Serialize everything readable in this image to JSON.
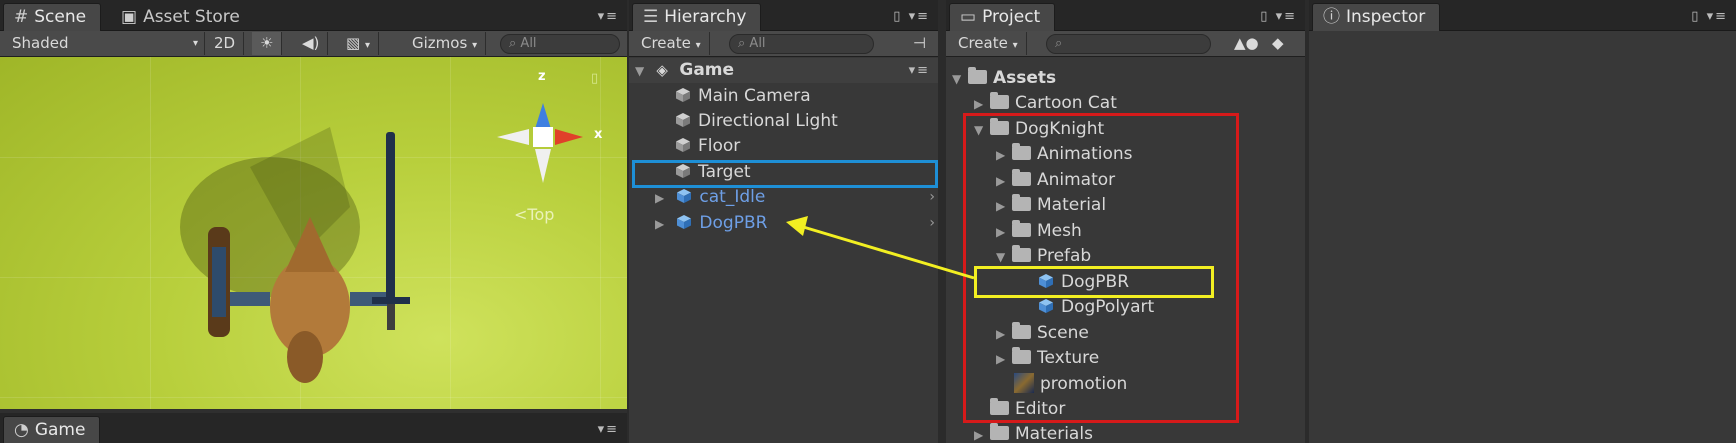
{
  "scene_panel": {
    "tabs": [
      {
        "label": "Scene"
      },
      {
        "label": "Asset Store"
      }
    ],
    "toolbar": {
      "shading": "Shaded",
      "mode_2d": "2D",
      "gizmos": "Gizmos",
      "search_placeholder": "All"
    },
    "gizmo": {
      "axis_z": "z",
      "axis_x": "x",
      "view_label": "Top"
    }
  },
  "game_tab": {
    "label": "Game"
  },
  "hierarchy": {
    "tab": "Hierarchy",
    "create": "Create",
    "search_placeholder": "All",
    "scene_name": "Game",
    "items": [
      {
        "label": "Main Camera"
      },
      {
        "label": "Directional Light"
      },
      {
        "label": "Floor"
      },
      {
        "label": "Target"
      },
      {
        "label": "cat_Idle"
      },
      {
        "label": "DogPBR"
      }
    ]
  },
  "project": {
    "tab": "Project",
    "create": "Create",
    "tree": [
      {
        "label": "Assets"
      },
      {
        "label": "Cartoon Cat"
      },
      {
        "label": "DogKnight"
      },
      {
        "label": "Animations"
      },
      {
        "label": "Animator"
      },
      {
        "label": "Material"
      },
      {
        "label": "Mesh"
      },
      {
        "label": "Prefab"
      },
      {
        "label": "DogPBR"
      },
      {
        "label": "DogPolyart"
      },
      {
        "label": "Scene"
      },
      {
        "label": "Texture"
      },
      {
        "label": "promotion"
      },
      {
        "label": "Editor"
      },
      {
        "label": "Materials"
      }
    ]
  },
  "inspector": {
    "tab": "Inspector"
  },
  "colors": {
    "highlight_blue": "#1e8fd6",
    "highlight_red": "#d61a1a",
    "highlight_yellow": "#f2ef22",
    "prefab_text": "#6e9fe6",
    "scene_green": "#b8cf3c"
  }
}
